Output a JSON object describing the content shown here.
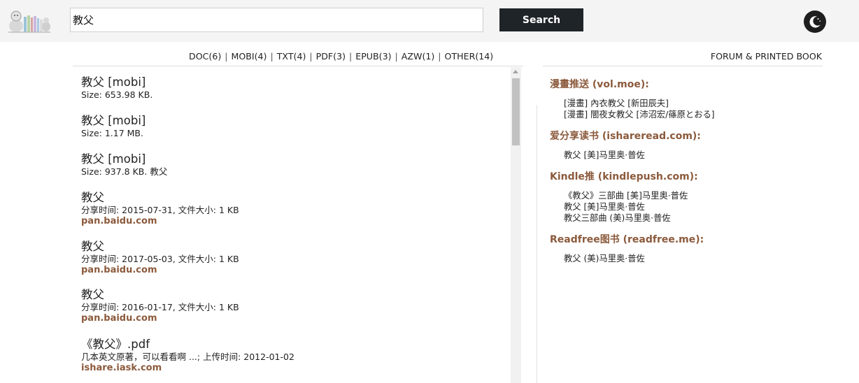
{
  "search": {
    "value": "教父",
    "button_label": "Search"
  },
  "filters": [
    {
      "label": "DOC(6)"
    },
    {
      "label": "MOBI(4)"
    },
    {
      "label": "TXT(4)"
    },
    {
      "label": "PDF(3)"
    },
    {
      "label": "EPUB(3)"
    },
    {
      "label": "AZW(1)"
    },
    {
      "label": "OTHER(14)"
    }
  ],
  "forum_link": "FORUM & PRINTED BOOK",
  "results": [
    {
      "title": "教父 [mobi]",
      "meta": "Size: 653.98 KB.",
      "source": ""
    },
    {
      "title": "教父 [mobi]",
      "meta": "Size: 1.17 MB.",
      "source": ""
    },
    {
      "title": "教父 [mobi]",
      "meta": "Size: 937.8 KB. 教父",
      "source": ""
    },
    {
      "title": "教父",
      "meta": "分享时间: 2015-07-31, 文件大小: 1 KB",
      "source": "pan.baidu.com"
    },
    {
      "title": "教父",
      "meta": "分享时间: 2017-05-03, 文件大小: 1 KB",
      "source": "pan.baidu.com"
    },
    {
      "title": "教父",
      "meta": "分享时间: 2016-01-17, 文件大小: 1 KB",
      "source": "pan.baidu.com"
    },
    {
      "title": "《教父》.pdf",
      "meta": "几本英文原著，可以看看啊 ...; 上传时间: 2012-01-02",
      "source": "ishare.iask.com"
    }
  ],
  "sidebar": [
    {
      "heading": "漫畫推送 (vol.moe):",
      "items": [
        "[漫畫] 內衣教父 [新田辰夫]",
        "[漫畫] 闇夜女教父 [沛沼宏/篠原とおる]"
      ]
    },
    {
      "heading": "爱分享读书 (ishareread.com):",
      "items": [
        "教父 [美]马里奥·普佐"
      ]
    },
    {
      "heading": "Kindle推 (kindlepush.com):",
      "items": [
        "《教父》三部曲 [美]马里奥·普佐",
        "教父 [美]马里奥·普佐",
        "教父三部曲 (美)马里奥·普佐"
      ]
    },
    {
      "heading": "Readfree图书 (readfree.me):",
      "items": [
        "教父 (美)马里奥·普佐"
      ]
    }
  ],
  "colors": {
    "accent_brown": "#8b5a3c",
    "search_button_bg": "#1f2428",
    "header_bg": "#f4f4f4"
  },
  "icons": {
    "logo": "bookshelf-logo-icon",
    "theme_toggle": "moon-icon"
  }
}
